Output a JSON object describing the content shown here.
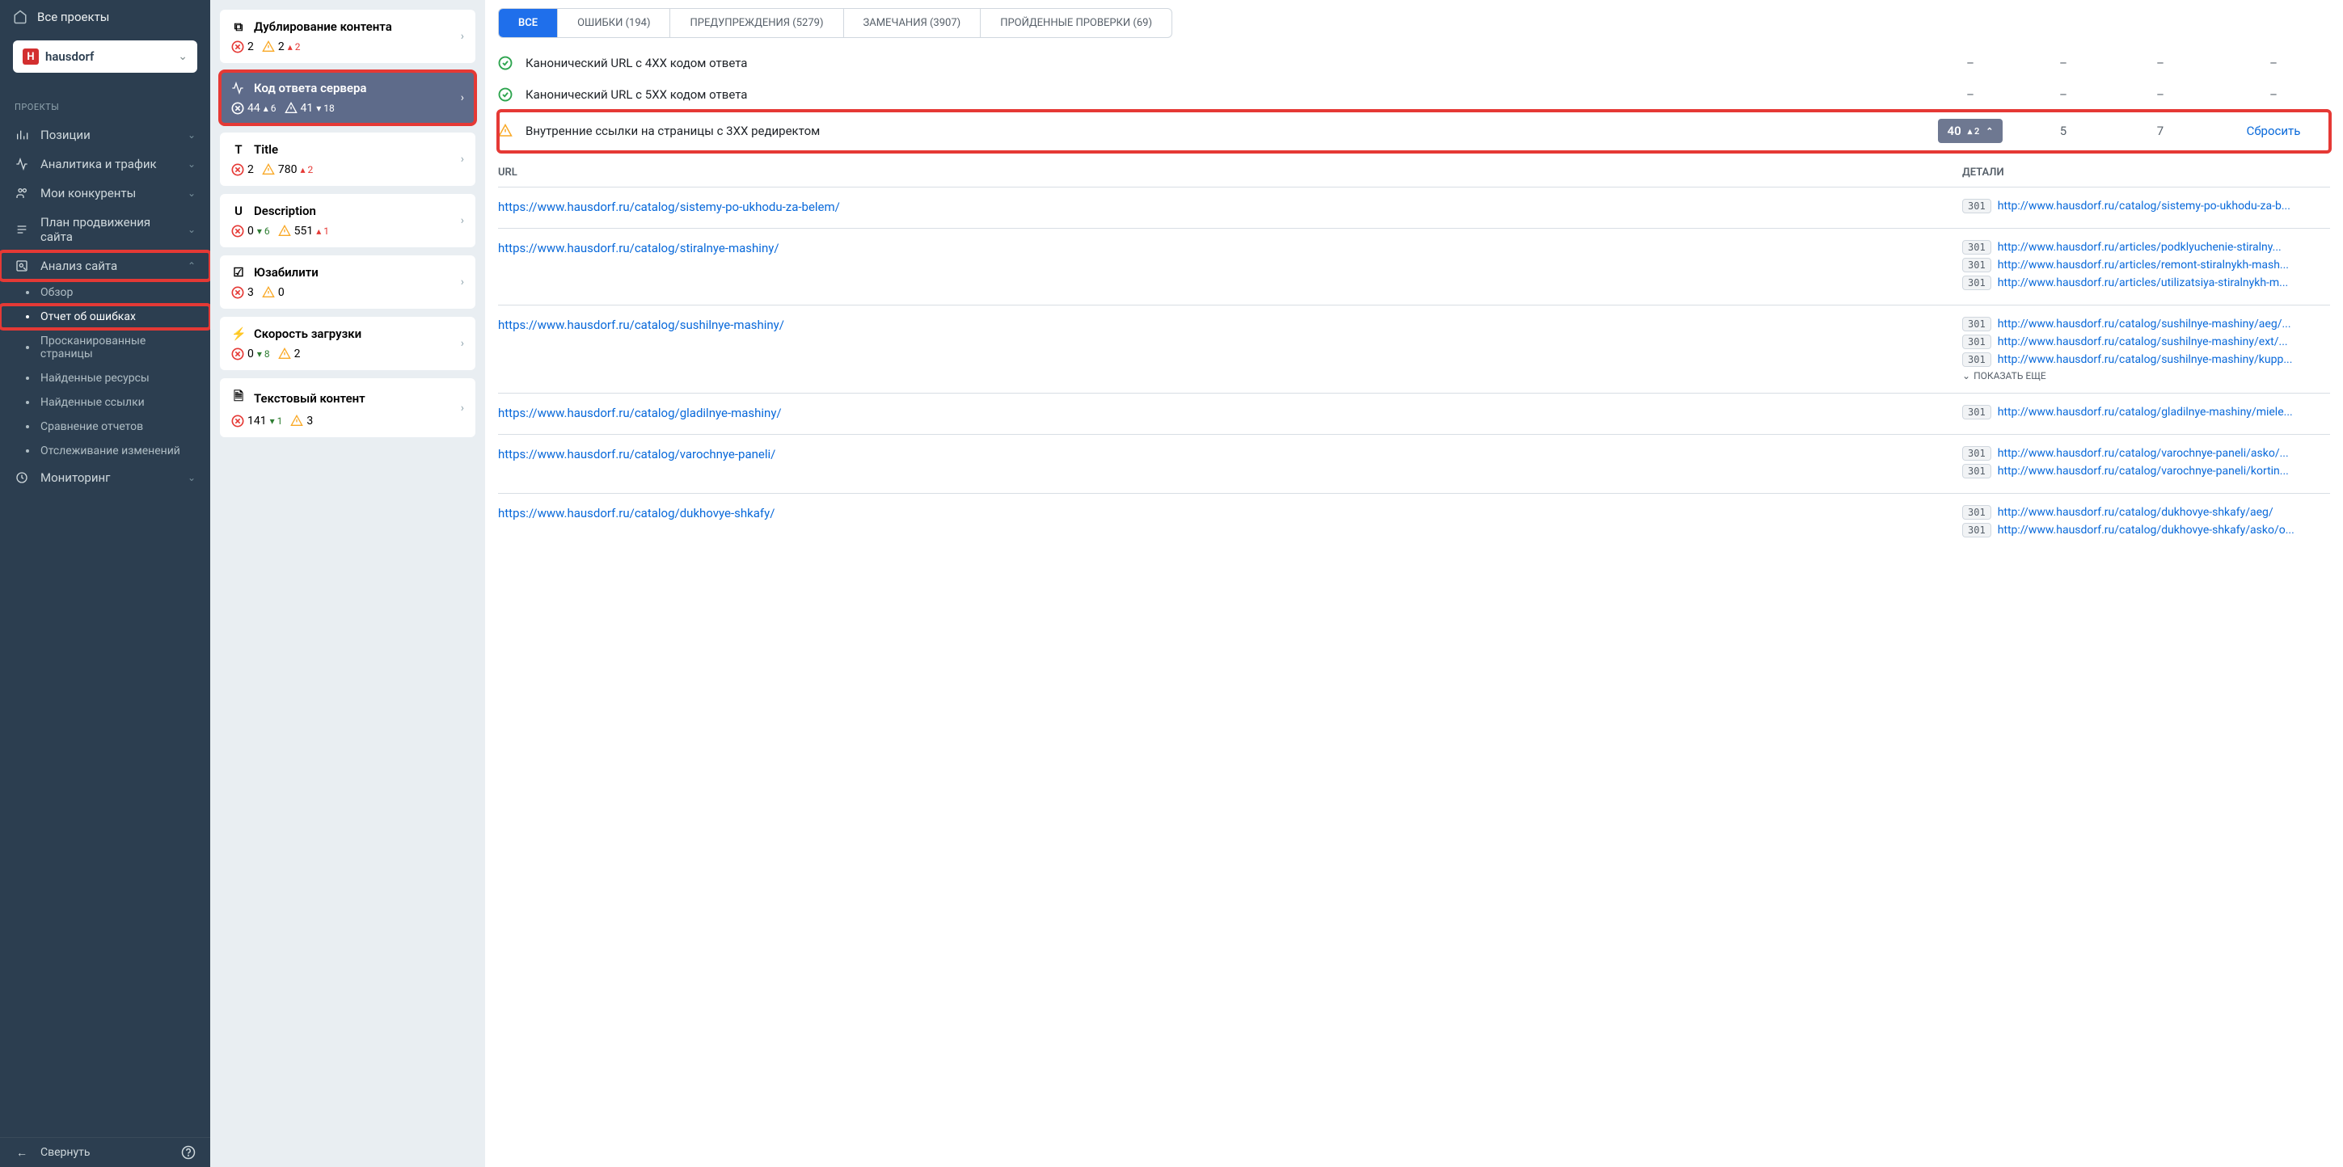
{
  "sidebar": {
    "all_projects": "Все проекты",
    "project_name": "hausdorf",
    "project_initial": "H",
    "section_label": "ПРОЕКТЫ",
    "items": [
      {
        "label": "Позиции"
      },
      {
        "label": "Аналитика и трафик"
      },
      {
        "label": "Мои конкуренты"
      },
      {
        "label": "План продвижения сайта"
      },
      {
        "label": "Анализ сайта"
      },
      {
        "label": "Мониторинг"
      }
    ],
    "sub_analysis": [
      {
        "label": "Обзор"
      },
      {
        "label": "Отчет об ошибках"
      },
      {
        "label": "Просканированные страницы"
      },
      {
        "label": "Найденные ресурсы"
      },
      {
        "label": "Найденные ссылки"
      },
      {
        "label": "Сравнение отчетов"
      },
      {
        "label": "Отслеживание изменений"
      }
    ],
    "collapse": "Свернуть"
  },
  "categories": [
    {
      "title": "Дублирование контента",
      "err": "2",
      "warn": "2",
      "warn_delta": "▴ 2"
    },
    {
      "title": "Код ответа сервера",
      "err": "44",
      "err_delta": "▴ 6",
      "warn": "41",
      "warn_delta": "▾ 18",
      "active": true
    },
    {
      "title": "Title",
      "err": "2",
      "warn": "780",
      "warn_delta": "▴ 2"
    },
    {
      "title": "Description",
      "err": "0",
      "err_delta": "▾ 6",
      "warn": "551",
      "warn_delta": "▴ 1"
    },
    {
      "title": "Юзабилити",
      "err": "3",
      "warn": "0"
    },
    {
      "title": "Скорость загрузки",
      "err": "0",
      "err_delta": "▾ 8",
      "warn": "2"
    },
    {
      "title": "Текстовый контент",
      "err": "141",
      "err_delta": "▾ 1",
      "warn": "3"
    }
  ],
  "tabs": [
    {
      "label": "ВСЕ",
      "active": true
    },
    {
      "label": "ОШИБКИ (194)"
    },
    {
      "label": "ПРЕДУПРЕЖДЕНИЯ (5279)"
    },
    {
      "label": "ЗАМЕЧАНИЯ (3907)"
    },
    {
      "label": "ПРОЙДЕННЫЕ ПРОВЕРКИ (69)"
    }
  ],
  "checks": [
    {
      "icon": "ok",
      "label": "Канонический URL с 4XX кодом ответа",
      "c1": "–",
      "c2": "–",
      "c3": "–",
      "c4": "–"
    },
    {
      "icon": "ok",
      "label": "Канонический URL с 5XX кодом ответа",
      "c1": "–",
      "c2": "–",
      "c3": "–",
      "c4": "–"
    },
    {
      "icon": "warn",
      "label": "Внутренние ссылки на страницы с 3XX редиректом",
      "badge_val": "40",
      "badge_delta": "▴ 2",
      "c2": "5",
      "c3": "7",
      "c4": "Сбросить",
      "expanded": true
    }
  ],
  "table": {
    "head_url": "URL",
    "head_details": "ДЕТАЛИ",
    "show_more": "ПОКАЗАТЬ ЕЩЕ",
    "rows": [
      {
        "url": "https://www.hausdorf.ru/catalog/sistemy-po-ukhodu-za-belem/",
        "details": [
          {
            "code": "301",
            "link": "http://www.hausdorf.ru/catalog/sistemy-po-ukhodu-za-b..."
          }
        ]
      },
      {
        "url": "https://www.hausdorf.ru/catalog/stiralnye-mashiny/",
        "details": [
          {
            "code": "301",
            "link": "http://www.hausdorf.ru/articles/podklyuchenie-stiralny..."
          },
          {
            "code": "301",
            "link": "http://www.hausdorf.ru/articles/remont-stiralnykh-mash..."
          },
          {
            "code": "301",
            "link": "http://www.hausdorf.ru/articles/utilizatsiya-stiralnykh-m..."
          }
        ]
      },
      {
        "url": "https://www.hausdorf.ru/catalog/sushilnye-mashiny/",
        "details": [
          {
            "code": "301",
            "link": "http://www.hausdorf.ru/catalog/sushilnye-mashiny/aeg/..."
          },
          {
            "code": "301",
            "link": "http://www.hausdorf.ru/catalog/sushilnye-mashiny/ext/..."
          },
          {
            "code": "301",
            "link": "http://www.hausdorf.ru/catalog/sushilnye-mashiny/kupp..."
          }
        ],
        "more": true
      },
      {
        "url": "https://www.hausdorf.ru/catalog/gladilnye-mashiny/",
        "details": [
          {
            "code": "301",
            "link": "http://www.hausdorf.ru/catalog/gladilnye-mashiny/miele..."
          }
        ]
      },
      {
        "url": "https://www.hausdorf.ru/catalog/varochnye-paneli/",
        "details": [
          {
            "code": "301",
            "link": "http://www.hausdorf.ru/catalog/varochnye-paneli/asko/..."
          },
          {
            "code": "301",
            "link": "http://www.hausdorf.ru/catalog/varochnye-paneli/kortin..."
          }
        ]
      },
      {
        "url": "https://www.hausdorf.ru/catalog/dukhovye-shkafy/",
        "details": [
          {
            "code": "301",
            "link": "http://www.hausdorf.ru/catalog/dukhovye-shkafy/aeg/"
          },
          {
            "code": "301",
            "link": "http://www.hausdorf.ru/catalog/dukhovye-shkafy/asko/o..."
          }
        ]
      }
    ]
  }
}
